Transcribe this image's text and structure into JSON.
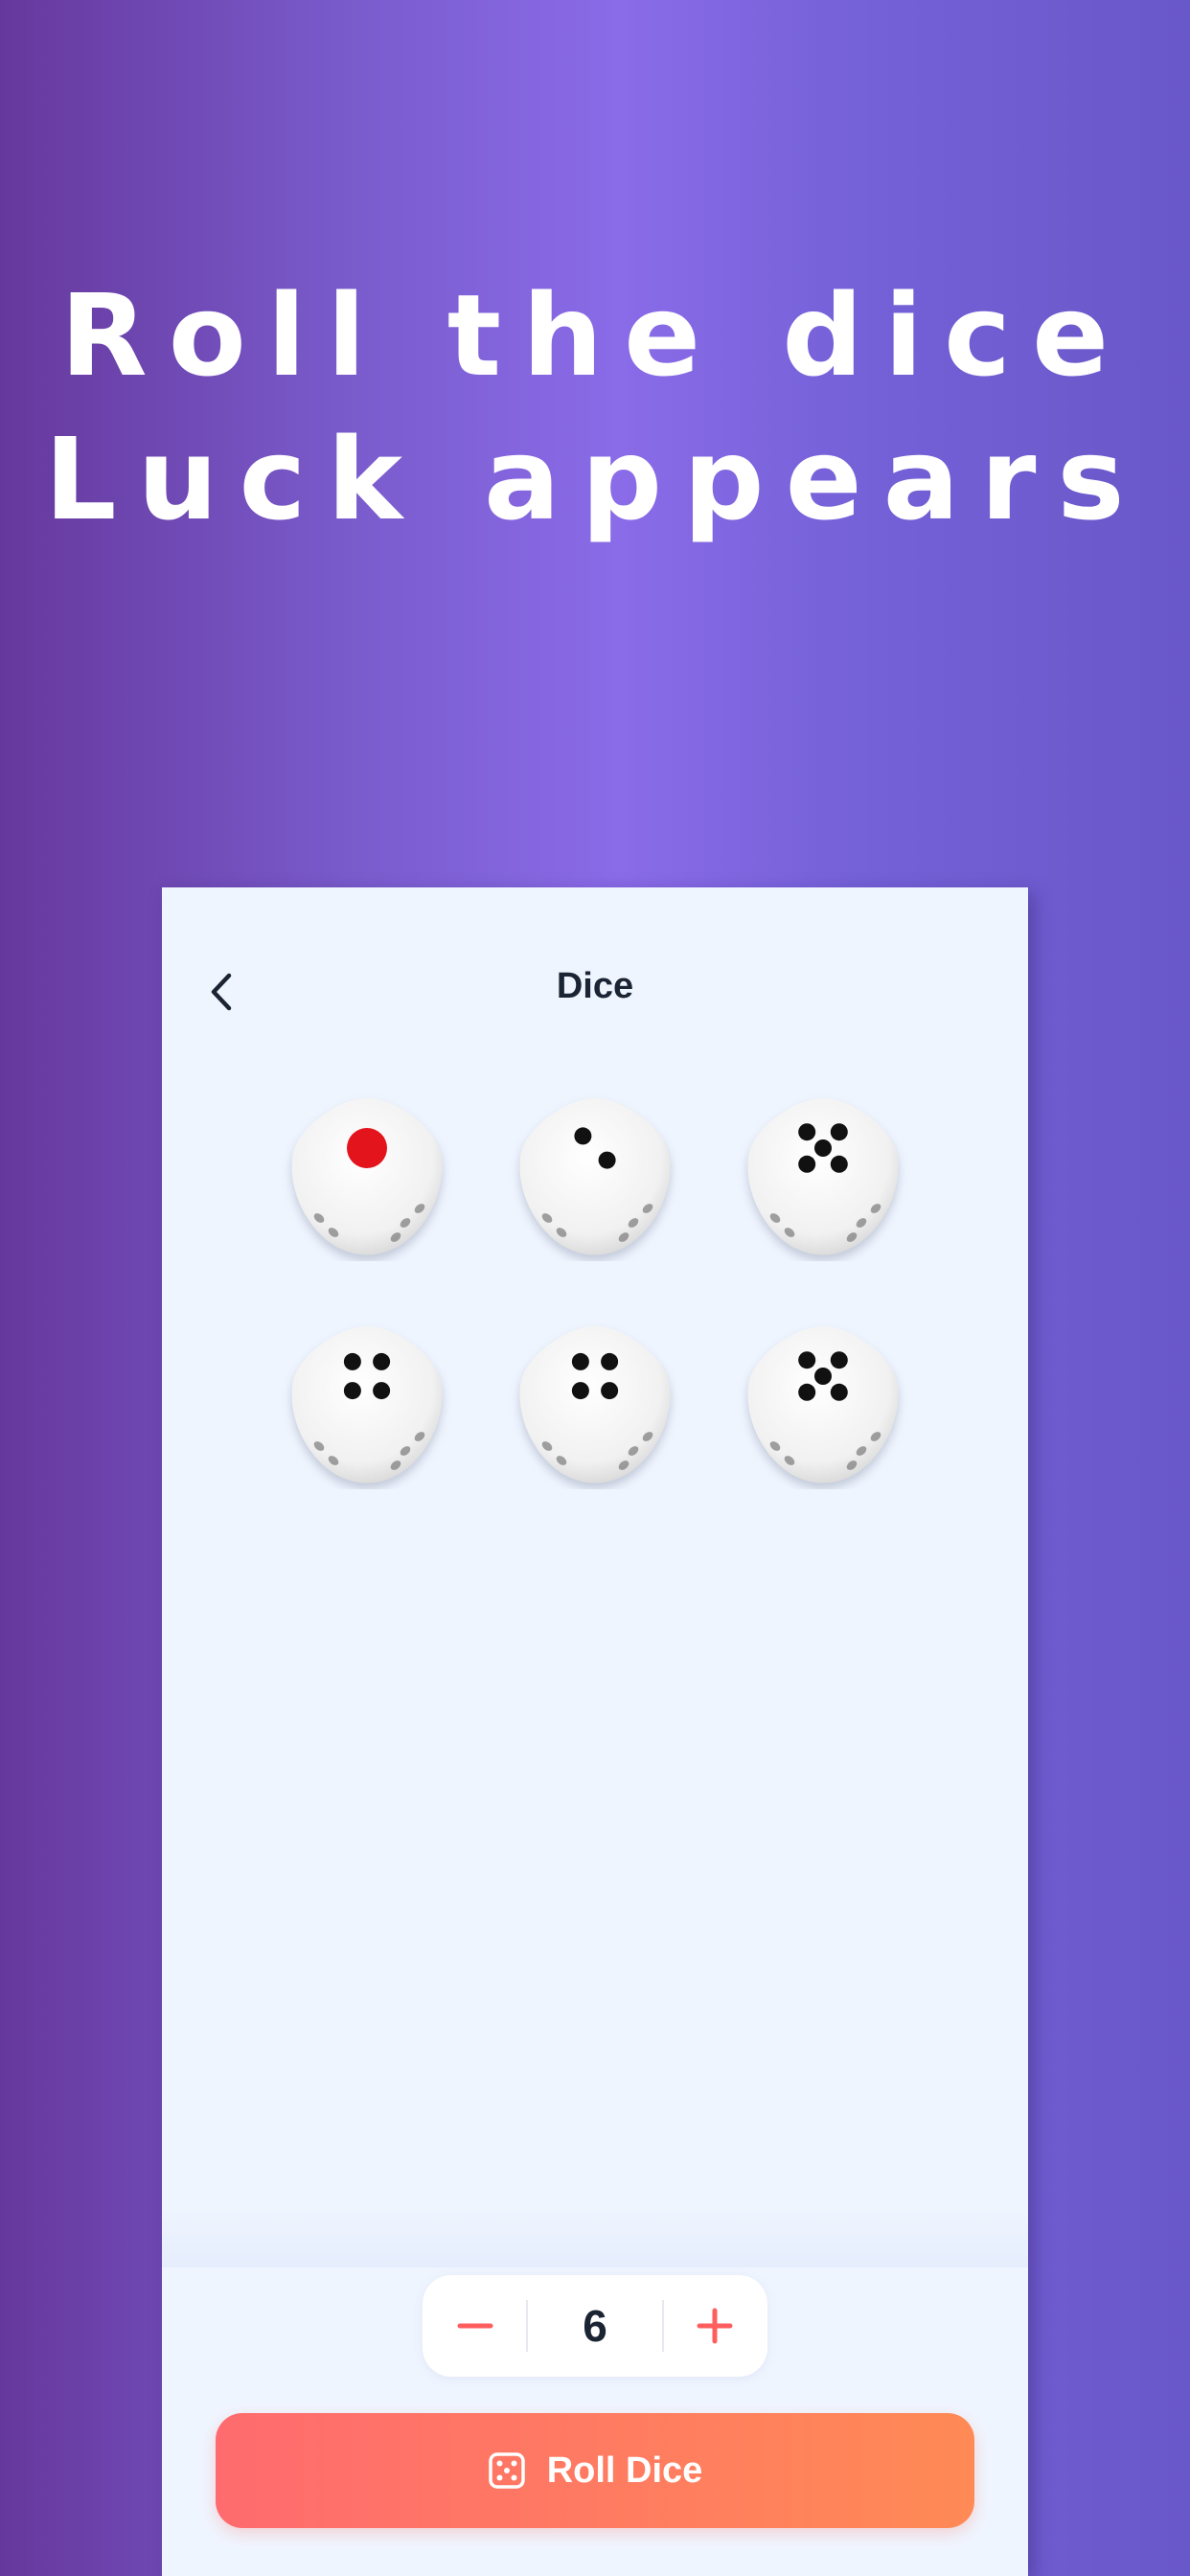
{
  "hero": {
    "line1": "Roll the dice",
    "line2": "Luck appears"
  },
  "nav": {
    "back_icon": "chevron-left-icon",
    "title": "Dice"
  },
  "dice": {
    "faces": [
      1,
      2,
      5,
      4,
      4,
      5
    ],
    "pip_color": "#111111",
    "one_pip_color": "#e3141c"
  },
  "stepper": {
    "minus_icon": "minus-icon",
    "value": "6",
    "plus_icon": "plus-icon"
  },
  "roll_button": {
    "icon": "dice-icon",
    "label": "Roll Dice"
  },
  "colors": {
    "accent": "#ff6b6e",
    "accent_end": "#ff8a55",
    "background": "#eff5ff"
  }
}
